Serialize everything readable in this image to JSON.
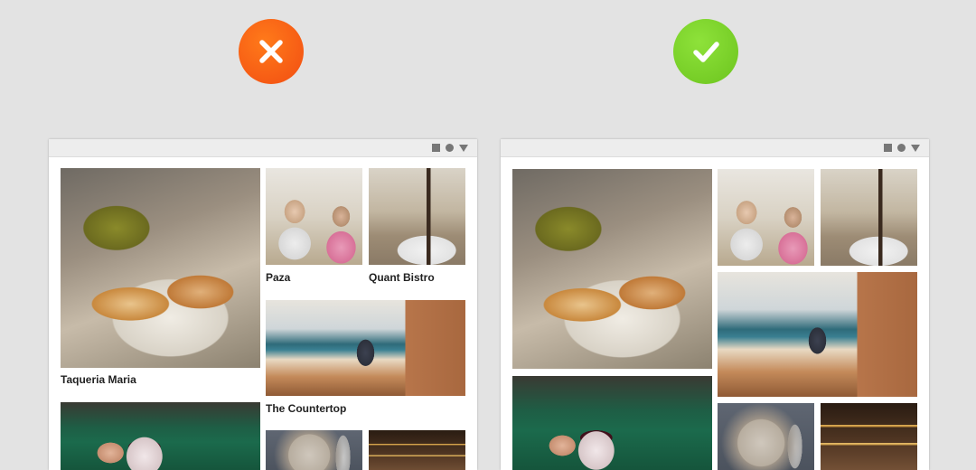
{
  "badges": {
    "bad": {
      "icon": "x-icon",
      "color": "#f24d12"
    },
    "good": {
      "icon": "checkmark-icon",
      "color": "#6cc41e"
    }
  },
  "window_controls": [
    "square-icon",
    "dot-icon",
    "triangle-down-icon"
  ],
  "bad_example": {
    "tiles": [
      {
        "name": "tacos-photo",
        "caption": "Taqueria Maria"
      },
      {
        "name": "paza-photo",
        "caption": "Paza"
      },
      {
        "name": "bistro-photo",
        "caption": "Quant Bistro"
      },
      {
        "name": "countertop-photo",
        "caption": "The Countertop"
      },
      {
        "name": "parfait-photo",
        "caption": ""
      },
      {
        "name": "plate-photo",
        "caption": ""
      },
      {
        "name": "lamps-photo",
        "caption": ""
      }
    ]
  },
  "good_example": {
    "tiles": [
      {
        "name": "tacos-photo",
        "caption": ""
      },
      {
        "name": "paza-photo",
        "caption": ""
      },
      {
        "name": "bistro-photo",
        "caption": ""
      },
      {
        "name": "countertop-photo",
        "caption": ""
      },
      {
        "name": "parfait-photo",
        "caption": ""
      },
      {
        "name": "plate-photo",
        "caption": ""
      },
      {
        "name": "lamps-photo",
        "caption": ""
      }
    ]
  }
}
